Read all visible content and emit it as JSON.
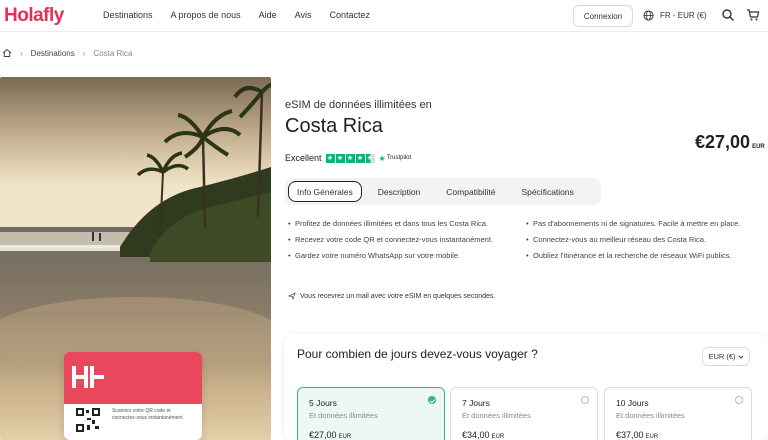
{
  "header": {
    "logo": "Holafly",
    "nav": [
      "Destinations",
      "A propos de nous",
      "Aide",
      "Avis",
      "Contactez"
    ],
    "login": "Connexion",
    "lang": "FR - EUR (€)",
    "icons": [
      "globe-icon",
      "search-icon",
      "cart-icon"
    ]
  },
  "breadcrumb": {
    "home_icon": "home-icon",
    "items": [
      "Destinations",
      "Costa Rica"
    ]
  },
  "esim_card": {
    "text": "Scannez votre QR code et connectez-vous instantanément"
  },
  "product": {
    "subtitle": "eSIM de données illimitées en",
    "title": "Costa Rica",
    "price": "€27,00",
    "price_unit": "EUR",
    "rating_label": "Excellent",
    "rating_stars": 4.5,
    "trustpilot": "Trustpilot"
  },
  "tabs": [
    "Info Générales",
    "Description",
    "Compatibilité",
    "Spécifications"
  ],
  "bullets_left": [
    "Profitez de données illimitées et dans tous les Costa Rica.",
    "Recevez votre code QR et connectez-vous instantanément.",
    "Gardez votre numéro WhatsApp sur votre mobile."
  ],
  "bullets_right": [
    "Pas d'abonnements ni de signatures. Facile à mettre en place.",
    "Connectez-vous au meilleur réseau des Costa Rica.",
    "Oubliez l'itinérance et la recherche de réseaux WiFi publics."
  ],
  "notice": "Vous recevrez un mail avec votre eSIM en quelques secondes.",
  "days": {
    "question": "Pour combien de jours devez-vous voyager ?",
    "currency": "EUR (€)",
    "plans": [
      {
        "days": "5 Jours",
        "data": "Et données illimitées",
        "price": "€27,00",
        "unit": "EUR",
        "selected": true
      },
      {
        "days": "7 Jours",
        "data": "Et données illimitées",
        "price": "€34,00",
        "unit": "EUR",
        "selected": false
      },
      {
        "days": "10 Jours",
        "data": "Et données illimitées",
        "price": "€37,00",
        "unit": "EUR",
        "selected": false
      }
    ]
  },
  "colors": {
    "brand": "#e5315a",
    "trustpilot": "#00b67a",
    "selected": "#36b37e"
  }
}
